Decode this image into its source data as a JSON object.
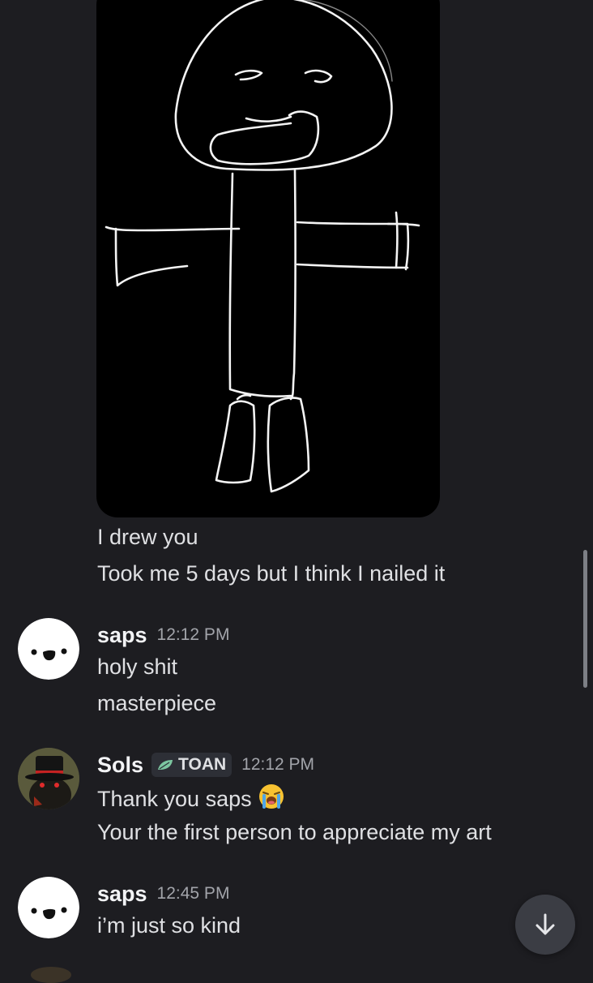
{
  "conversation": {
    "continuation": {
      "attachment_icon": "stick-figure-drawing",
      "lines": [
        "I drew you",
        "Took me 5 days but I think I nailed it"
      ]
    },
    "msg_saps_1": {
      "username": "saps",
      "timestamp": "12:12 PM",
      "avatar_icon": "smiley-face-avatar",
      "lines": [
        "holy shit",
        "masterpiece"
      ]
    },
    "msg_sols": {
      "username": "Sols",
      "tag": "TOAN",
      "tag_icon": "leaf-icon",
      "timestamp": "12:12 PM",
      "avatar_icon": "top-hat-character-avatar",
      "line1": "Thank you saps",
      "line1_emoji": "loudly-crying-face-emoji",
      "line2": "Your the first person to appreciate my art"
    },
    "msg_saps_2": {
      "username": "saps",
      "timestamp": "12:45 PM",
      "avatar_icon": "smiley-face-avatar",
      "lines": [
        "i’m just so kind"
      ]
    }
  },
  "controls": {
    "jump_to_present_icon": "arrow-down-icon"
  },
  "colors": {
    "background": "#1d1d21",
    "text": "#dfe0e3",
    "timestamp": "#a2a4aa",
    "tag_background": "#2d2f36",
    "jump_button": "#3b3d44"
  }
}
